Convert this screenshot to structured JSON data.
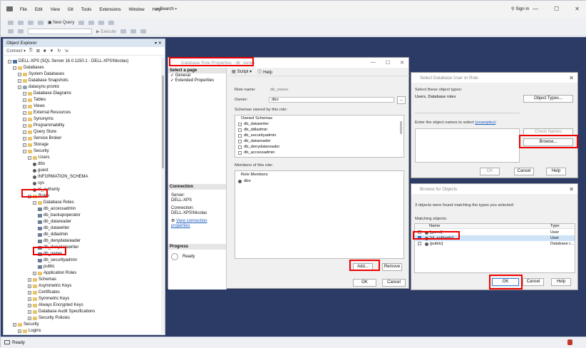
{
  "app": {
    "menu": [
      "File",
      "Edit",
      "View",
      "Git",
      "Tools",
      "Extensions",
      "Window",
      "Help"
    ],
    "search": "Search",
    "signin": "Sign in",
    "toolbar": {
      "new_query": "New Query",
      "execute": "Execute"
    },
    "status": "Ready"
  },
  "object_explorer": {
    "title": "Object Explorer",
    "connect": "Connect",
    "tree": [
      {
        "label": "DELL-XPS (SQL Server 16.0.1150.1 - DELL-XPS\\Nicolas)",
        "level": 0,
        "icon": "server"
      },
      {
        "label": "Databases",
        "level": 1,
        "icon": "folder"
      },
      {
        "label": "System Databases",
        "level": 2,
        "icon": "folder"
      },
      {
        "label": "Database Snapshots",
        "level": 2,
        "icon": "folder"
      },
      {
        "label": "datasync-pronto",
        "level": 2,
        "icon": "db"
      },
      {
        "label": "Database Diagrams",
        "level": 3,
        "icon": "folder"
      },
      {
        "label": "Tables",
        "level": 3,
        "icon": "folder"
      },
      {
        "label": "Views",
        "level": 3,
        "icon": "folder"
      },
      {
        "label": "External Resources",
        "level": 3,
        "icon": "folder"
      },
      {
        "label": "Synonyms",
        "level": 3,
        "icon": "folder"
      },
      {
        "label": "Programmability",
        "level": 3,
        "icon": "folder"
      },
      {
        "label": "Query Store",
        "level": 3,
        "icon": "folder"
      },
      {
        "label": "Service Broker",
        "level": 3,
        "icon": "folder"
      },
      {
        "label": "Storage",
        "level": 3,
        "icon": "folder"
      },
      {
        "label": "Security",
        "level": 3,
        "icon": "folder"
      },
      {
        "label": "Users",
        "level": 4,
        "icon": "folder"
      },
      {
        "label": "dbo",
        "level": 5,
        "icon": "user"
      },
      {
        "label": "guest",
        "level": 5,
        "icon": "user"
      },
      {
        "label": "INFORMATION_SCHEMA",
        "level": 5,
        "icon": "user"
      },
      {
        "label": "sys",
        "level": 5,
        "icon": "user"
      },
      {
        "label": "nl_authority",
        "level": 5,
        "icon": "user"
      },
      {
        "label": "Roles",
        "level": 4,
        "icon": "folder"
      },
      {
        "label": "Database Roles",
        "level": 5,
        "icon": "folder"
      },
      {
        "label": "db_accessadmin",
        "level": 6,
        "icon": "role"
      },
      {
        "label": "db_backupoperator",
        "level": 6,
        "icon": "role"
      },
      {
        "label": "db_datareader",
        "level": 6,
        "icon": "role"
      },
      {
        "label": "db_datawriter",
        "level": 6,
        "icon": "role"
      },
      {
        "label": "db_ddladmin",
        "level": 6,
        "icon": "role"
      },
      {
        "label": "db_denydatareader",
        "level": 6,
        "icon": "role"
      },
      {
        "label": "db_denydatawriter",
        "level": 6,
        "icon": "role"
      },
      {
        "label": "db_owner",
        "level": 6,
        "icon": "role"
      },
      {
        "label": "db_securityadmin",
        "level": 6,
        "icon": "role"
      },
      {
        "label": "public",
        "level": 6,
        "icon": "role"
      },
      {
        "label": "Application Roles",
        "level": 5,
        "icon": "folder"
      },
      {
        "label": "Schemas",
        "level": 4,
        "icon": "folder"
      },
      {
        "label": "Asymmetric Keys",
        "level": 4,
        "icon": "folder"
      },
      {
        "label": "Certificates",
        "level": 4,
        "icon": "folder"
      },
      {
        "label": "Symmetric Keys",
        "level": 4,
        "icon": "folder"
      },
      {
        "label": "Always Encrypted Keys",
        "level": 4,
        "icon": "folder"
      },
      {
        "label": "Database Audit Specifications",
        "level": 4,
        "icon": "folder"
      },
      {
        "label": "Security Policies",
        "level": 4,
        "icon": "folder"
      },
      {
        "label": "Security",
        "level": 1,
        "icon": "folder"
      },
      {
        "label": "Logins",
        "level": 2,
        "icon": "folder"
      }
    ]
  },
  "role_dialog": {
    "title": "Database Role Properties - db_owner",
    "select_page": "Select a page",
    "pages": [
      "General",
      "Extended Properties"
    ],
    "script": "Script",
    "help": "Help",
    "role_name_label": "Role name:",
    "role_name": "db_owner",
    "owner_label": "Owner:",
    "owner": "dbo",
    "owner_btn": "...",
    "schemas_label": "Schemas owned by this role:",
    "schemas_header": "Owned Schemas",
    "schemas": [
      "db_datawriter",
      "db_ddladmin",
      "db_securityadmin",
      "db_datareader",
      "db_denydatareader",
      "db_accessadmin"
    ],
    "members_label": "Members of this role:",
    "members_header": "Role Members",
    "members": [
      "dbo"
    ],
    "connection_head": "Connection",
    "server_label": "Server:",
    "server": "DELL-XPS",
    "connection_label": "Connection:",
    "connection": "DELL-XPS\\Nicolas",
    "view_conn": "View connection properties",
    "progress_head": "Progress",
    "progress_status": "Ready",
    "add": "Add...",
    "remove": "Remove",
    "ok": "OK",
    "cancel": "Cancel"
  },
  "select_dialog": {
    "title": "Select Database User or Role",
    "types_label": "Select these object types:",
    "types_value": "Users, Database roles",
    "object_types": "Object Types...",
    "names_label": "Enter the object names to select",
    "examples": "(examples)",
    "check_names": "Check Names",
    "browse": "Browse...",
    "ok": "OK",
    "cancel": "Cancel",
    "help": "Help"
  },
  "browse_dialog": {
    "title": "Browse for Objects",
    "found": "3 objects were found matching the types you selected",
    "matching": "Matching objects:",
    "col_name": "Name",
    "col_type": "Type",
    "rows": [
      {
        "name": "[guest]",
        "type": "User",
        "checked": false
      },
      {
        "name": "[nl_authority]",
        "type": "User",
        "checked": true
      },
      {
        "name": "[public]",
        "type": "Database r...",
        "checked": false
      }
    ],
    "ok": "OK",
    "cancel": "Cancel",
    "help": "Help"
  },
  "colors": {
    "workspace": "#2b3b66",
    "highlight": "#e00000",
    "accent": "#2b6fd6"
  }
}
